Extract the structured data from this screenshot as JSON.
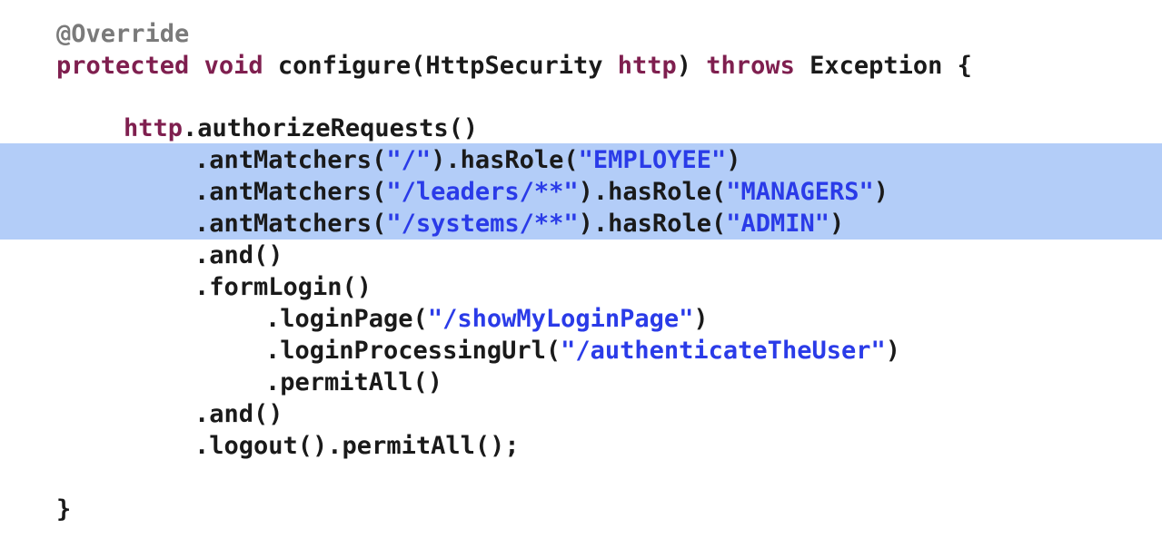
{
  "code": {
    "lines": [
      {
        "tokens": [
          {
            "t": "@Override",
            "c": "ann"
          }
        ]
      },
      {
        "tokens": [
          {
            "t": "protected",
            "c": "kw"
          },
          {
            "t": " ",
            "c": "pl"
          },
          {
            "t": "void",
            "c": "kw"
          },
          {
            "t": " configure(HttpSecurity ",
            "c": "pl"
          },
          {
            "t": "http",
            "c": "fld"
          },
          {
            "t": ") ",
            "c": "pl"
          },
          {
            "t": "throws",
            "c": "kw"
          },
          {
            "t": " Exception {",
            "c": "pl"
          }
        ]
      },
      {
        "tokens": []
      },
      {
        "tokens": [
          {
            "t": "http",
            "c": "fld"
          },
          {
            "t": ".authorizeRequests()",
            "c": "pl"
          }
        ]
      },
      {
        "tokens": [
          {
            "t": ".antMatchers(",
            "c": "pl"
          },
          {
            "t": "\"/\"",
            "c": "str"
          },
          {
            "t": ").hasRole(",
            "c": "pl"
          },
          {
            "t": "\"EMPLOYEE\"",
            "c": "str"
          },
          {
            "t": ")",
            "c": "pl"
          }
        ]
      },
      {
        "tokens": [
          {
            "t": ".antMatchers(",
            "c": "pl"
          },
          {
            "t": "\"/leaders/**\"",
            "c": "str"
          },
          {
            "t": ").hasRole(",
            "c": "pl"
          },
          {
            "t": "\"MANAGERS\"",
            "c": "str"
          },
          {
            "t": ")",
            "c": "pl"
          }
        ]
      },
      {
        "tokens": [
          {
            "t": ".antMatchers(",
            "c": "pl"
          },
          {
            "t": "\"/systems/**\"",
            "c": "str"
          },
          {
            "t": ").hasRole(",
            "c": "pl"
          },
          {
            "t": "\"ADMIN\"",
            "c": "str"
          },
          {
            "t": ")",
            "c": "pl"
          }
        ]
      },
      {
        "tokens": [
          {
            "t": ".and()",
            "c": "pl"
          }
        ]
      },
      {
        "tokens": [
          {
            "t": ".formLogin()",
            "c": "pl"
          }
        ]
      },
      {
        "tokens": [
          {
            "t": ".loginPage(",
            "c": "pl"
          },
          {
            "t": "\"/showMyLoginPage\"",
            "c": "str"
          },
          {
            "t": ")",
            "c": "pl"
          }
        ]
      },
      {
        "tokens": [
          {
            "t": ".loginProcessingUrl(",
            "c": "pl"
          },
          {
            "t": "\"/authenticateTheUser\"",
            "c": "str"
          },
          {
            "t": ")",
            "c": "pl"
          }
        ]
      },
      {
        "tokens": [
          {
            "t": ".permitAll()",
            "c": "pl"
          }
        ]
      },
      {
        "tokens": [
          {
            "t": ".and()",
            "c": "pl"
          }
        ]
      },
      {
        "tokens": [
          {
            "t": ".logout().permitAll();",
            "c": "pl"
          }
        ]
      },
      {
        "tokens": []
      },
      {
        "tokens": [
          {
            "t": "}",
            "c": "pl"
          }
        ]
      }
    ],
    "highlighted_lines": [
      4,
      5,
      6
    ],
    "highlight_color": "#b3cdf8",
    "colors": {
      "annotation": "#7a7a7a",
      "keyword": "#7f1f4f",
      "string": "#2a3be8",
      "plain": "#1a1a1a"
    }
  }
}
